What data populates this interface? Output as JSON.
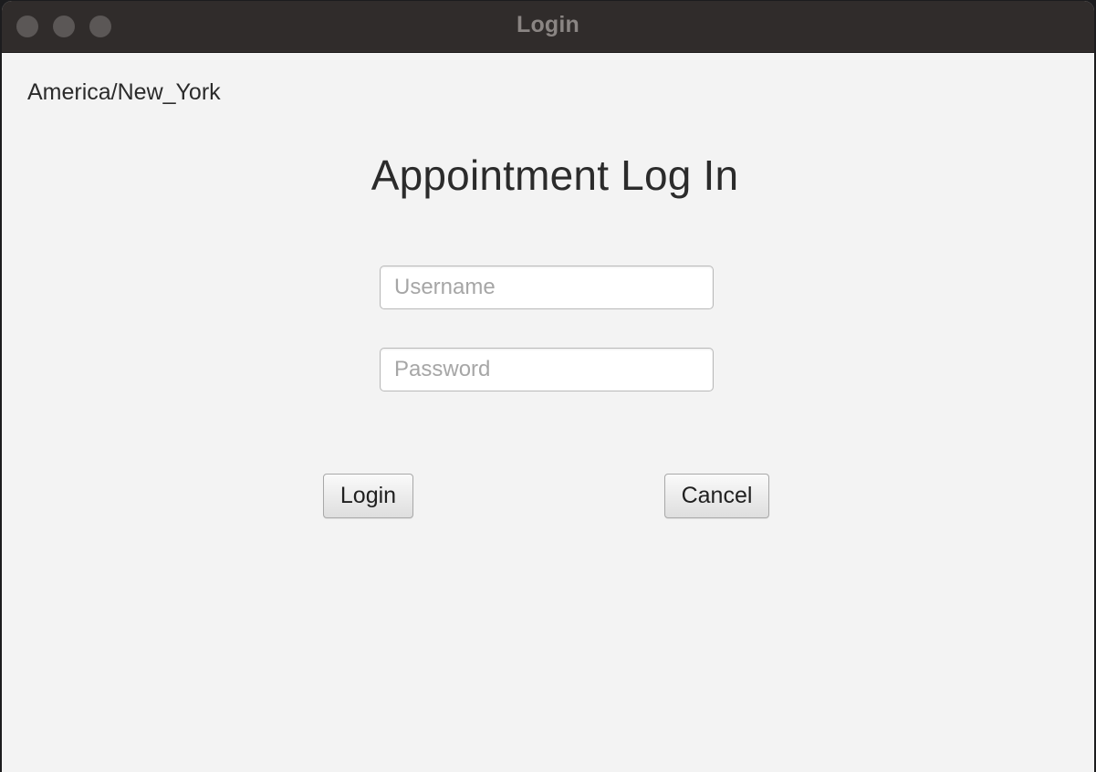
{
  "window": {
    "title": "Login"
  },
  "timezone_label": "America/New_York",
  "heading": "Appointment Log In",
  "username": {
    "value": "",
    "placeholder": "Username"
  },
  "password": {
    "value": "",
    "placeholder": "Password"
  },
  "buttons": {
    "login_label": "Login",
    "cancel_label": "Cancel"
  },
  "colors": {
    "titlebar": "#302c2b",
    "background": "#f3f3f3",
    "text": "#2b2b2b",
    "placeholder": "#a6a6a6"
  }
}
